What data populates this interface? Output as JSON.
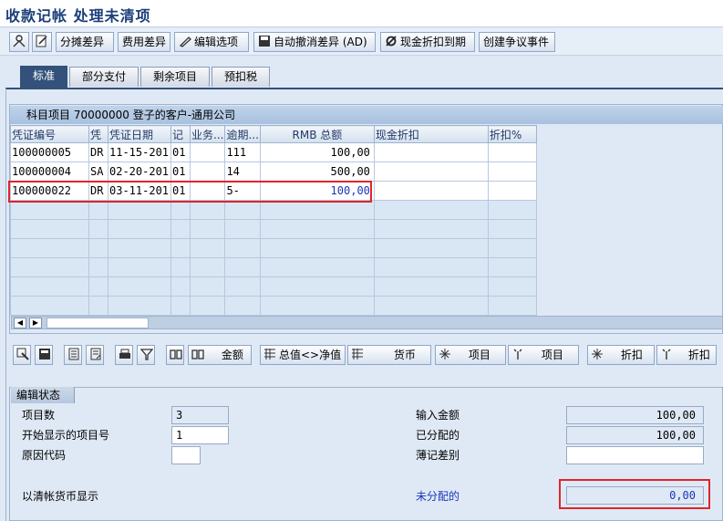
{
  "title": "收款记帐 处理未清项",
  "toolbar": {
    "buttons": [
      "分摊差异",
      "费用差异",
      "编辑选项",
      "自动撤消差异 (AD)",
      "现金折扣到期",
      "创建争议事件"
    ]
  },
  "tabs": [
    "标准",
    "部分支付",
    "剩余项目",
    "预扣税"
  ],
  "table": {
    "caption": "科目项目 70000000 登子的客户-通用公司",
    "columns": [
      "凭证编号",
      "凭",
      "凭证日期",
      "记",
      "业务...",
      "逾期...",
      "RMB 总额",
      "现金折扣",
      "折扣%"
    ],
    "rows": [
      [
        "100000005",
        "DR",
        "11-15-201",
        "01",
        "",
        "111",
        "100,00",
        "",
        ""
      ],
      [
        "100000004",
        "SA",
        "02-20-201",
        "01",
        "",
        "14",
        "500,00",
        "",
        ""
      ],
      [
        "100000022",
        "DR",
        "03-11-201",
        "01",
        "",
        "5-",
        "100,00",
        "",
        ""
      ]
    ]
  },
  "lower_toolbar": {
    "amount": "金额",
    "gross_net": "总值<>净值",
    "currency": "货币",
    "item1": "项目",
    "item2": "项目",
    "discount1": "折扣",
    "discount2": "折扣"
  },
  "edit_status": {
    "tab": "编辑状态",
    "item_count_label": "项目数",
    "item_count": "3",
    "first_item_label": "开始显示的项目号",
    "first_item": "1",
    "reason_code_label": "原因代码",
    "reason_code": "",
    "display_label": "以清帐货币显示",
    "entered_amount_label": "输入金额",
    "entered_amount": "100,00",
    "assigned_label": "已分配的",
    "assigned": "100,00",
    "diff_label": "薄记差别",
    "diff": "",
    "unassigned_label": "未分配的",
    "unassigned": "0,00"
  }
}
